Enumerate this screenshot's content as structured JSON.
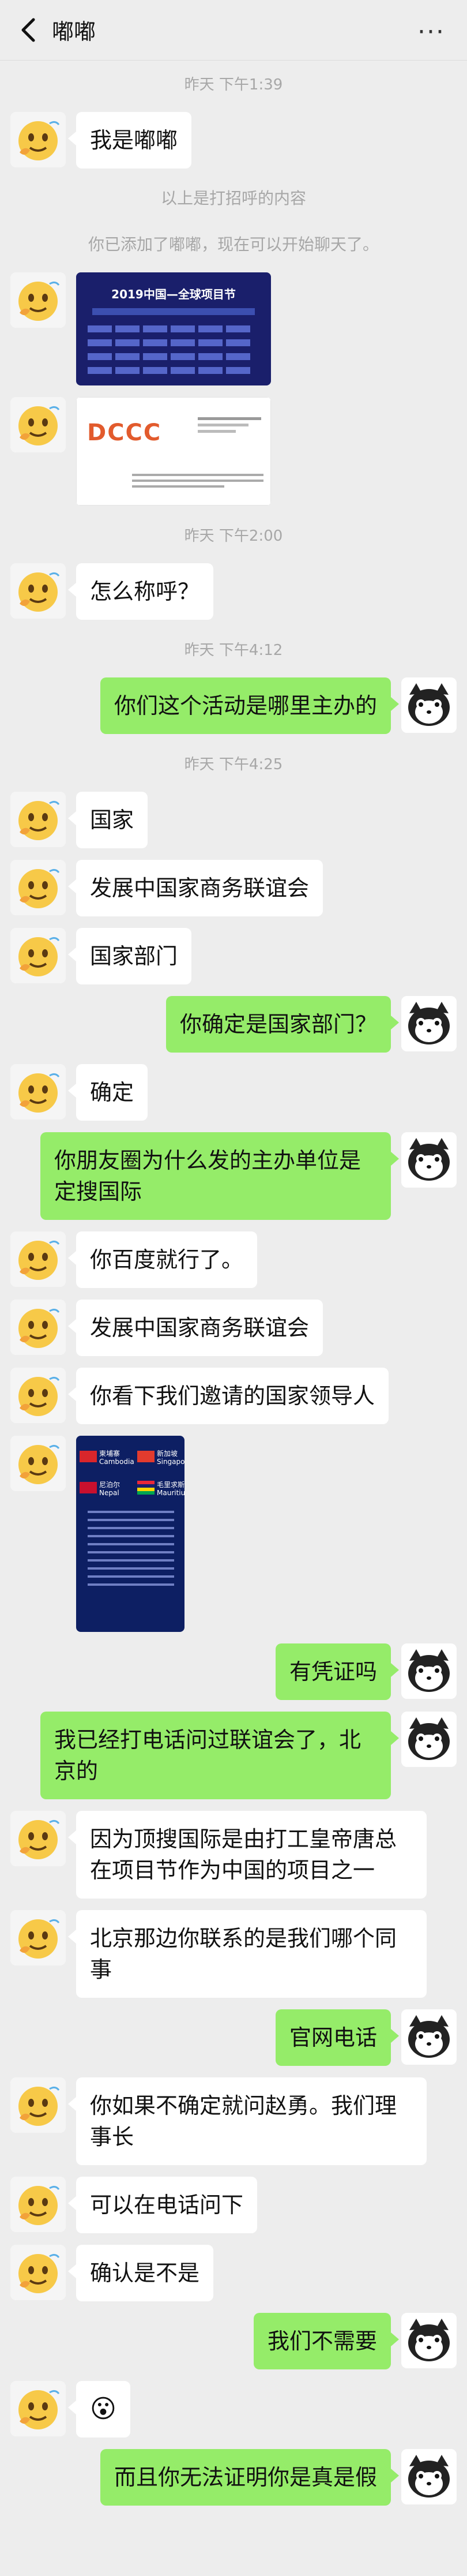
{
  "header": {
    "title": "嘟嘟",
    "more_label": "···"
  },
  "messages": [
    {
      "type": "time",
      "text": "昨天 下午1:39"
    },
    {
      "type": "text",
      "side": "l",
      "text": "我是嘟嘟"
    },
    {
      "type": "system",
      "text": "以上是打招呼的内容"
    },
    {
      "type": "system",
      "text": "你已添加了嘟嘟，现在可以开始聊天了。"
    },
    {
      "type": "image",
      "side": "l",
      "variant": "poster",
      "img_text": [
        "2019中国—全球项目节"
      ]
    },
    {
      "type": "image",
      "side": "l",
      "variant": "card",
      "img_text": [
        "DCCC"
      ]
    },
    {
      "type": "time",
      "text": "昨天 下午2:00"
    },
    {
      "type": "text",
      "side": "l",
      "text": "怎么称呼？"
    },
    {
      "type": "time",
      "text": "昨天 下午4:12"
    },
    {
      "type": "text",
      "side": "r",
      "text": "你们这个活动是哪里主办的"
    },
    {
      "type": "time",
      "text": "昨天 下午4:25"
    },
    {
      "type": "text",
      "side": "l",
      "text": "国家"
    },
    {
      "type": "text",
      "side": "l",
      "text": "发展中国家商务联谊会"
    },
    {
      "type": "text",
      "side": "l",
      "text": "国家部门"
    },
    {
      "type": "text",
      "side": "r",
      "text": "你确定是国家部门？"
    },
    {
      "type": "text",
      "side": "l",
      "text": "确定"
    },
    {
      "type": "text",
      "side": "r",
      "text": "你朋友圈为什么发的主办单位是定搜国际"
    },
    {
      "type": "text",
      "side": "l",
      "text": "你百度就行了。"
    },
    {
      "type": "text",
      "side": "l",
      "text": "发展中国家商务联谊会"
    },
    {
      "type": "text",
      "side": "l",
      "text": "你看下我们邀请的国家领导人"
    },
    {
      "type": "image",
      "side": "l",
      "variant": "leaders",
      "img_text": [
        "柬埔寨",
        "Cambodia",
        "新加坡",
        "Singapore",
        "尼泊尔",
        "Nepal",
        "毛里求斯",
        "Mauritius"
      ]
    },
    {
      "type": "text",
      "side": "r",
      "text": "有凭证吗"
    },
    {
      "type": "text",
      "side": "r",
      "text": "我已经打电话问过联谊会了，北京的"
    },
    {
      "type": "text",
      "side": "l",
      "text": "因为顶搜国际是由打工皇帝唐总在项目节作为中国的项目之一"
    },
    {
      "type": "text",
      "side": "l",
      "text": "北京那边你联系的是我们哪个同事"
    },
    {
      "type": "text",
      "side": "r",
      "text": "官网电话"
    },
    {
      "type": "text",
      "side": "l",
      "text": "你如果不确定就问赵勇。我们理事长"
    },
    {
      "type": "text",
      "side": "l",
      "text": "可以在电话问下"
    },
    {
      "type": "text",
      "side": "l",
      "text": "确认是不是"
    },
    {
      "type": "text",
      "side": "r",
      "text": "我们不需要"
    },
    {
      "type": "text",
      "side": "l",
      "text": "😮",
      "emoji": true
    },
    {
      "type": "text",
      "side": "r",
      "text": "而且你无法证明你是真是假"
    }
  ]
}
